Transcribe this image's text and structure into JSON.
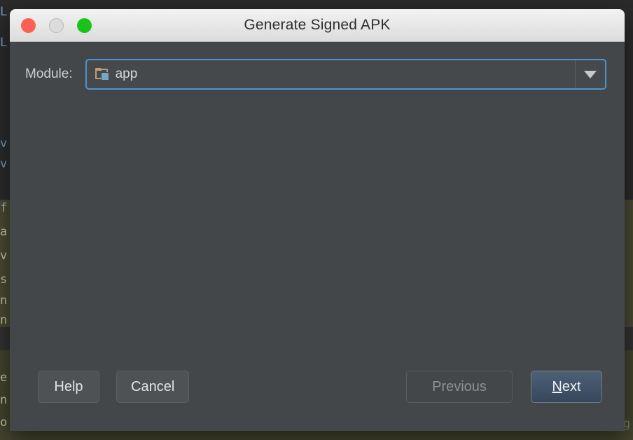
{
  "background": {
    "description": "android-studio-code-editor",
    "code_fragments": [
      {
        "text": "L",
        "color": "#7a9ec2"
      },
      {
        "text": "L",
        "color": "#7a9ec2"
      },
      {
        "text": "v",
        "color": "#7a9ec2"
      },
      {
        "text": "v",
        "color": "#7a9ec2"
      },
      {
        "text": "f",
        "color": "#9aa6b5"
      },
      {
        "text": "a",
        "color": "#c8c8a0"
      },
      {
        "text": "v",
        "color": "#c8c8a0"
      },
      {
        "text": "s",
        "color": "#c8c8a0"
      },
      {
        "text": "n",
        "color": "#c8c8a0"
      },
      {
        "text": "n",
        "color": "#c8c8a0"
      },
      {
        "text": "e",
        "color": "#c8c8a0"
      },
      {
        "text": "n",
        "color": "#c8c8a0"
      },
      {
        "text": "o",
        "color": "#c8c8a0"
      },
      {
        "text": "g",
        "color": "#6a8759"
      }
    ]
  },
  "dialog": {
    "title": "Generate Signed APK",
    "titlebar": {
      "close_label": "Close",
      "minimize_label": "Minimize",
      "zoom_label": "Zoom",
      "close_color": "#ff5f52",
      "minimize_color": "#dcdcdc",
      "zoom_color": "#19c319"
    },
    "form": {
      "module": {
        "label": "Module:",
        "value": "app",
        "icon": "module-folder-icon",
        "dropdown_icon": "chevron-down-icon",
        "focused": true,
        "focus_color": "#4d94cf"
      }
    },
    "buttons": {
      "help": "Help",
      "cancel": "Cancel",
      "previous": "Previous",
      "next_mnemonic": "N",
      "next_rest": "ext",
      "next_full": "Next"
    }
  }
}
